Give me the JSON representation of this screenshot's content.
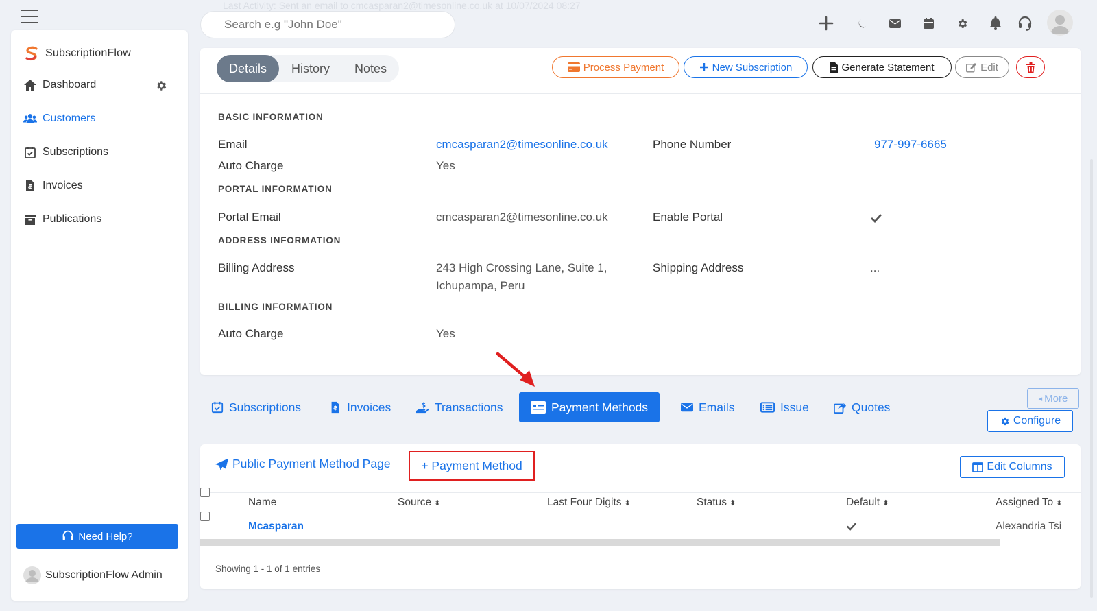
{
  "topbar": {
    "activity_text": "Last Activity:  Sent an email to cmcasparan2@timesonline.co.uk at 10/07/2024 08:27",
    "search_placeholder": "Search e.g \"John Doe\""
  },
  "sidebar": {
    "brand": "SubscriptionFlow",
    "items": [
      {
        "label": "Dashboard"
      },
      {
        "label": "Customers"
      },
      {
        "label": "Subscriptions"
      },
      {
        "label": "Invoices"
      },
      {
        "label": "Publications"
      }
    ],
    "help_label": "Need Help?",
    "admin_name": "SubscriptionFlow Admin"
  },
  "details": {
    "tabs": [
      {
        "label": "Details"
      },
      {
        "label": "History"
      },
      {
        "label": "Notes"
      }
    ],
    "actions": {
      "process_payment": "Process Payment",
      "new_subscription": "New Subscription",
      "generate_statement": "Generate Statement",
      "edit": "Edit"
    },
    "sections": {
      "basic": "BASIC INFORMATION",
      "portal": "PORTAL INFORMATION",
      "address": "ADDRESS INFORMATION",
      "billing": "BILLING INFORMATION"
    },
    "fields": {
      "email_label": "Email",
      "email_value": "cmcasparan2@timesonline.co.uk",
      "phone_label": "Phone Number",
      "phone_value": "977-997-6665",
      "auto_charge_label": "Auto Charge",
      "auto_charge_value": "Yes",
      "portal_email_label": "Portal Email",
      "portal_email_value": "cmcasparan2@timesonline.co.uk",
      "enable_portal_label": "Enable Portal",
      "billing_address_label": "Billing Address",
      "billing_address_line1": "243 High Crossing Lane, Suite 1,",
      "billing_address_line2": "Ichupampa, Peru",
      "shipping_address_label": "Shipping Address",
      "shipping_address_value": "...",
      "billing_auto_charge_label": "Auto Charge",
      "billing_auto_charge_value": "Yes"
    }
  },
  "subtabs": [
    {
      "label": "Subscriptions"
    },
    {
      "label": "Invoices"
    },
    {
      "label": "Transactions"
    },
    {
      "label": "Payment Methods"
    },
    {
      "label": "Emails"
    },
    {
      "label": "Issue"
    },
    {
      "label": "Quotes"
    }
  ],
  "more_label": "More",
  "configure_label": "Configure",
  "payment_methods": {
    "public_page_label": "Public Payment Method Page",
    "add_label": "+ Payment Method",
    "edit_columns_label": "Edit Columns",
    "columns": [
      "Name",
      "Source",
      "Last Four Digits",
      "Status",
      "Default",
      "Assigned To"
    ],
    "rows": [
      {
        "name": "Mcasparan",
        "source": "",
        "last_four": "",
        "status": "",
        "assigned_to": "Alexandria Tsi"
      }
    ],
    "showing": "Showing 1 - 1 of 1 entries"
  },
  "colors": {
    "primary": "#1a73e8",
    "process_payment": "#f0772f",
    "danger": "#e02020",
    "active_tab": "#6c7a8b"
  }
}
